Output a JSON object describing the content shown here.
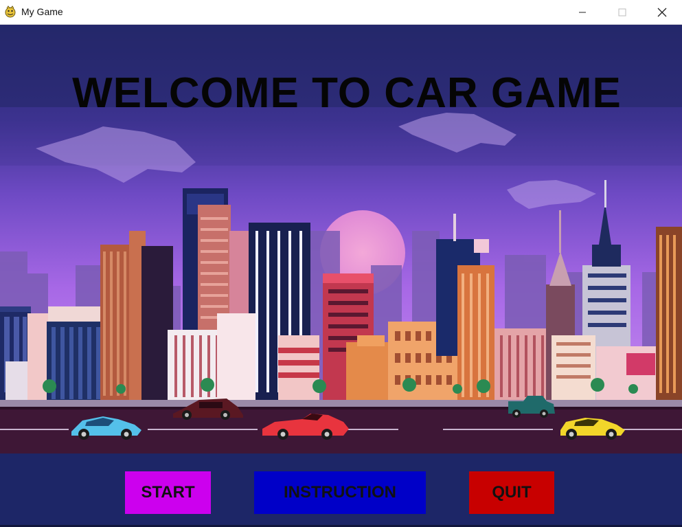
{
  "window": {
    "title": "My Game",
    "app_icon": "pygame-snake-icon",
    "controls": {
      "minimize": "minimize-icon",
      "maximize": "maximize-icon",
      "close": "close-icon"
    }
  },
  "game": {
    "headline": "WELCOME TO CAR GAME",
    "buttons": {
      "start": "START",
      "instruction": "INSTRUCTION",
      "quit": "QUIT"
    }
  },
  "colors": {
    "background": "#1d2667",
    "start_button": "#cc00ee",
    "instruction_button": "#0000c8",
    "quit_button": "#c80000",
    "headline": "#050505",
    "road": "#3e1736",
    "sky_top": "#2a2d78",
    "sky_bottom": "#b46ee8"
  }
}
